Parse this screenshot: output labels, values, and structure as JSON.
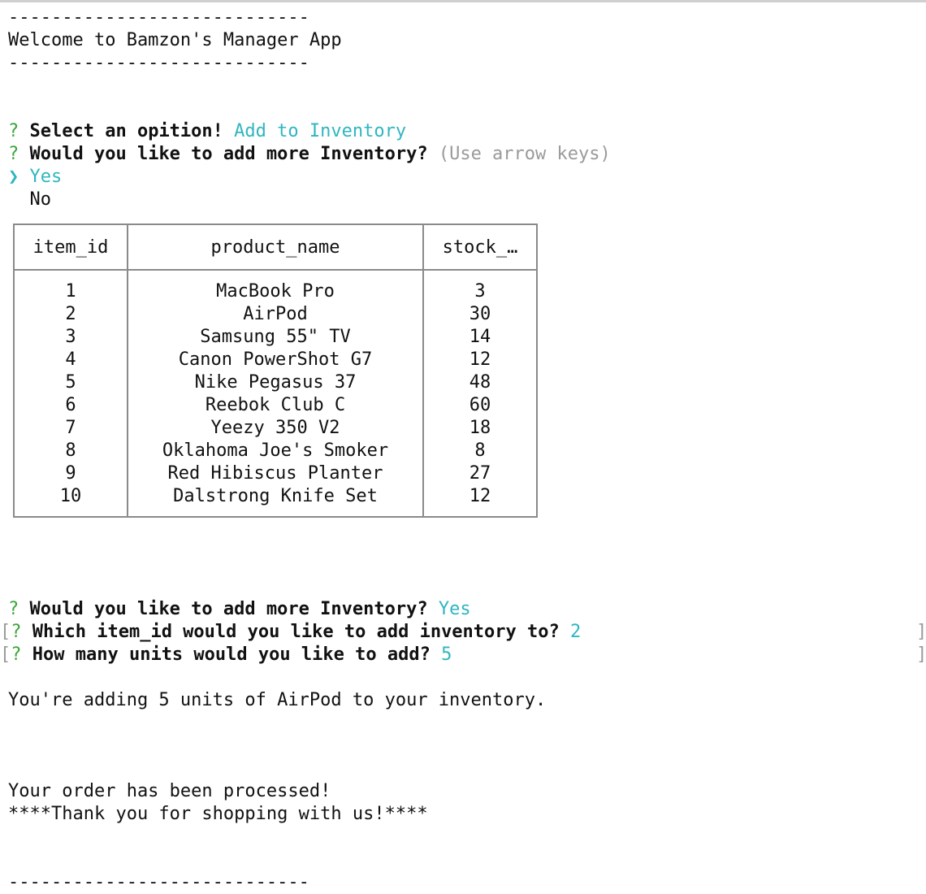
{
  "header": {
    "rule": "----------------------------",
    "title": "Welcome to Bamzon's Manager App"
  },
  "prompt1": {
    "mark": "?",
    "question": "Select an opition!",
    "answer": "Add to Inventory"
  },
  "prompt2": {
    "mark": "?",
    "question": "Would you like to add more Inventory?",
    "hint": "(Use arrow keys)"
  },
  "choices": {
    "pointer": "❯",
    "selected": "Yes",
    "other": "No"
  },
  "table": {
    "headers": [
      "item_id",
      "product_name",
      "stock_…"
    ],
    "rows": [
      {
        "id": "1",
        "name": "MacBook Pro",
        "stock": "3"
      },
      {
        "id": "2",
        "name": "AirPod",
        "stock": "30"
      },
      {
        "id": "3",
        "name": "Samsung 55\" TV",
        "stock": "14"
      },
      {
        "id": "4",
        "name": "Canon PowerShot G7",
        "stock": "12"
      },
      {
        "id": "5",
        "name": "Nike Pegasus 37",
        "stock": "48"
      },
      {
        "id": "6",
        "name": "Reebok Club C",
        "stock": "60"
      },
      {
        "id": "7",
        "name": "Yeezy 350 V2",
        "stock": "18"
      },
      {
        "id": "8",
        "name": "Oklahoma Joe's Smoker",
        "stock": "8"
      },
      {
        "id": "9",
        "name": "Red Hibiscus Planter",
        "stock": "27"
      },
      {
        "id": "10",
        "name": "Dalstrong Knife Set",
        "stock": "12"
      }
    ]
  },
  "prompt3": {
    "mark": "?",
    "question": "Would you like to add more Inventory?",
    "answer": "Yes"
  },
  "prompt4": {
    "bracket_open": "[",
    "mark": "?",
    "question": "Which item_id would you like to add inventory to?",
    "answer": "2",
    "bracket_close": "]"
  },
  "prompt5": {
    "bracket_open": "[",
    "mark": "?",
    "question": "How many units would you like to add?",
    "answer": "5",
    "bracket_close": "]"
  },
  "message1": "You're adding 5 units of AirPod to your inventory.",
  "message2": "Your order has been processed!",
  "message3": "****Thank you for shopping with us!****",
  "footer": {
    "rule": "----------------------------"
  }
}
